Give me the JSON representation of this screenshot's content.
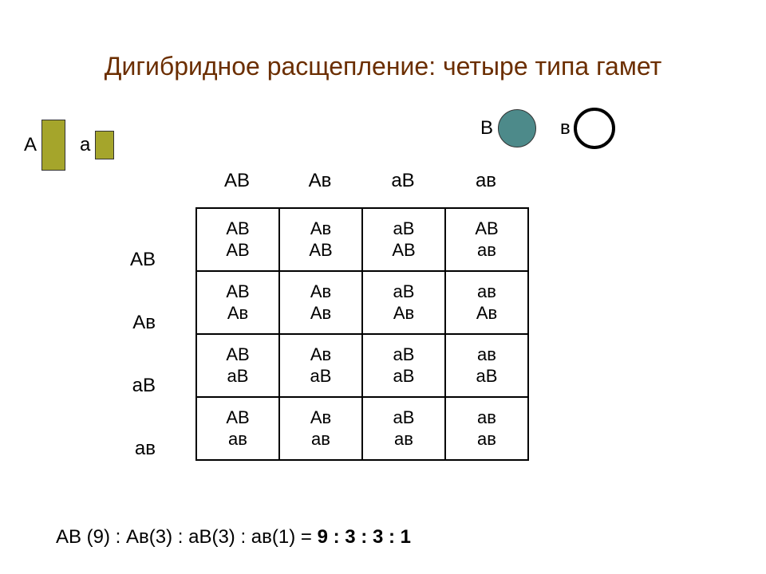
{
  "title": "Дигибридное расщепление: четыре типа гамет",
  "legend": {
    "A": "А",
    "a": "а",
    "B": "В",
    "v": "в"
  },
  "col_headers": [
    "АВ",
    "Ав",
    "аВ",
    "ав"
  ],
  "row_headers": [
    "АВ",
    "Ав",
    "аВ",
    "ав"
  ],
  "cells": [
    [
      [
        "АВ",
        "АВ"
      ],
      [
        "Ав",
        "АВ"
      ],
      [
        "аВ",
        "АВ"
      ],
      [
        "АВ",
        "ав"
      ]
    ],
    [
      [
        "АВ",
        "Ав"
      ],
      [
        "Ав",
        "Ав"
      ],
      [
        "аВ",
        "Ав"
      ],
      [
        "ав",
        "Ав"
      ]
    ],
    [
      [
        "АВ",
        "аВ"
      ],
      [
        "Ав",
        "аВ"
      ],
      [
        "аВ",
        "аВ"
      ],
      [
        "ав",
        "аВ"
      ]
    ],
    [
      [
        "АВ",
        "ав"
      ],
      [
        "Ав",
        "ав"
      ],
      [
        "аВ",
        "ав"
      ],
      [
        "ав",
        "ав"
      ]
    ]
  ],
  "ratio_left": "АВ (9) : Ав(3) : аВ(3) : ав(1) = ",
  "ratio_bold": "9 : 3 : 3 : 1",
  "chart_data": {
    "type": "table",
    "description": "Punnett square 4x4 dihybrid cross",
    "col_gametes": [
      "АВ",
      "Ав",
      "аВ",
      "ав"
    ],
    "row_gametes": [
      "АВ",
      "Ав",
      "аВ",
      "ав"
    ],
    "phenotype_ratio": {
      "АВ": 9,
      "Ав": 3,
      "аВ": 3,
      "ав": 1
    }
  }
}
